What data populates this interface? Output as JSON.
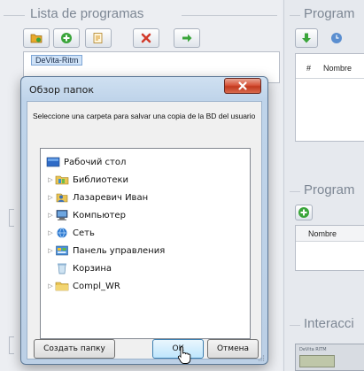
{
  "left_panel": {
    "title": "Lista de programas",
    "toolbar": [
      {
        "name": "open-folder-button",
        "icon": "folder-icon",
        "color": "#e8a92b"
      },
      {
        "name": "add-button",
        "icon": "plus-circle-icon",
        "color": "#3aa53a"
      },
      {
        "name": "edit-button",
        "icon": "document-edit-icon",
        "color": "#d89b2a"
      },
      {
        "name": "delete-button",
        "icon": "close-x-icon",
        "color": "#d23a2a"
      },
      {
        "name": "next-button",
        "icon": "arrow-right-icon",
        "color": "#3aa53a"
      }
    ],
    "tree_item": "DeVita-Ritm"
  },
  "right_panel": {
    "section1_title": "Program",
    "grid_headers": [
      "#",
      "Nombre"
    ],
    "section2_title": "Program",
    "grid2_header": "Nombre",
    "section3_title": "Interacci",
    "thumbnail_label": "DeVita RITM"
  },
  "dialog": {
    "title": "Обзор папок",
    "description": "Seleccione una carpeta para salvar una copia de la BD del usuario",
    "folders": [
      {
        "label": "Рабочий стол",
        "icon": "desktop-icon",
        "has_arrow": false,
        "indent": 0
      },
      {
        "label": "Библиотеки",
        "icon": "libraries-icon",
        "has_arrow": true,
        "indent": 1
      },
      {
        "label": "Лазаревич Иван",
        "icon": "user-folder-icon",
        "has_arrow": true,
        "indent": 1
      },
      {
        "label": "Компьютер",
        "icon": "computer-icon",
        "has_arrow": true,
        "indent": 1
      },
      {
        "label": "Сеть",
        "icon": "network-icon",
        "has_arrow": true,
        "indent": 1
      },
      {
        "label": "Панель управления",
        "icon": "control-panel-icon",
        "has_arrow": true,
        "indent": 1
      },
      {
        "label": "Корзина",
        "icon": "recycle-bin-icon",
        "has_arrow": false,
        "indent": 1
      },
      {
        "label": "Compl_WR",
        "icon": "folder-icon",
        "has_arrow": true,
        "indent": 1
      }
    ],
    "buttons": {
      "new_folder": "Создать папку",
      "ok": "OK",
      "cancel": "Отмена"
    }
  }
}
